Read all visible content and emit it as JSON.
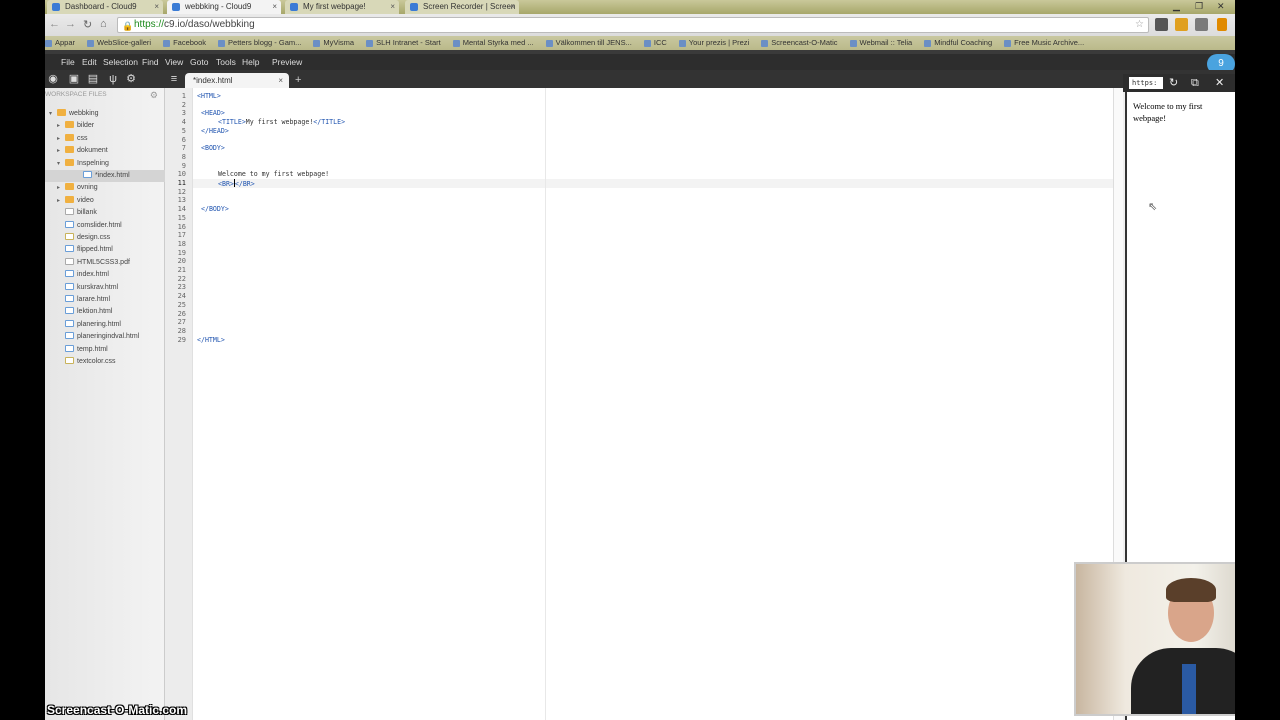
{
  "browser": {
    "tabs": [
      {
        "title": "Dashboard - Cloud9",
        "active": false
      },
      {
        "title": "webbking - Cloud9",
        "active": true
      },
      {
        "title": "My first webpage!",
        "active": false
      },
      {
        "title": "Screen Recorder | Screen",
        "active": false
      }
    ],
    "address": {
      "scheme": "https://",
      "rest": "c9.io/daso/webbking"
    },
    "bookmarks": [
      "Appar",
      "WebSlice-galleri",
      "Facebook",
      "Petters blogg - Gam...",
      "MyVisma",
      "SLH Intranet - Start",
      "Mental Styrka med ...",
      "Välkommen till JENS...",
      "ICC",
      "Your prezis | Prezi",
      "Screencast-O-Matic",
      "Webmail :: Telia",
      "Mindful Coaching",
      "Free Music Archive..."
    ]
  },
  "menu": {
    "items": [
      "File",
      "Edit",
      "Selection",
      "Find",
      "View",
      "Goto",
      "Tools",
      "Help",
      "Preview"
    ]
  },
  "editor_tab": {
    "label": "*index.html",
    "add": "+"
  },
  "sidebar": {
    "header": "WORKSPACE FILES",
    "tree": [
      {
        "label": "webbking",
        "type": "folder",
        "level": 0,
        "expanded": true
      },
      {
        "label": "bilder",
        "type": "folder",
        "level": 1
      },
      {
        "label": "css",
        "type": "folder",
        "level": 1
      },
      {
        "label": "dokument",
        "type": "folder",
        "level": 1
      },
      {
        "label": "Inspelning",
        "type": "folder",
        "level": 1,
        "expanded": true
      },
      {
        "label": "*index.html",
        "type": "html",
        "level": 2,
        "selected": true
      },
      {
        "label": "ovning",
        "type": "folder",
        "level": 1
      },
      {
        "label": "video",
        "type": "folder",
        "level": 1
      },
      {
        "label": "billank",
        "type": "file",
        "level": 1
      },
      {
        "label": "comslider.html",
        "type": "html",
        "level": 1
      },
      {
        "label": "design.css",
        "type": "css",
        "level": 1
      },
      {
        "label": "flipped.html",
        "type": "html",
        "level": 1
      },
      {
        "label": "HTML5CSS3.pdf",
        "type": "file",
        "level": 1
      },
      {
        "label": "index.html",
        "type": "html",
        "level": 1
      },
      {
        "label": "kurskrav.html",
        "type": "html",
        "level": 1
      },
      {
        "label": "larare.html",
        "type": "html",
        "level": 1
      },
      {
        "label": "lektion.html",
        "type": "html",
        "level": 1
      },
      {
        "label": "planering.html",
        "type": "html",
        "level": 1
      },
      {
        "label": "planeringindval.html",
        "type": "html",
        "level": 1
      },
      {
        "label": "temp.html",
        "type": "html",
        "level": 1
      },
      {
        "label": "textcolor.css",
        "type": "css",
        "level": 1
      }
    ]
  },
  "code": {
    "line_count": 29,
    "active_line": 11,
    "lines": {
      "1": "<HTML>",
      "3": "<HEAD>",
      "4_tag_open": "<TITLE>",
      "4_text": "My first webpage!",
      "4_tag_close": "</TITLE>",
      "5": "</HEAD>",
      "7": "<BODY>",
      "10": "Welcome to my first webpage!",
      "11_open": "<BR>",
      "11_close": "</BR>",
      "14": "</BODY>",
      "29": "</HTML>"
    }
  },
  "preview": {
    "url": "https:",
    "content": "Welcome to my first webpage!"
  },
  "watermark": "Screencast-O-Matic.com",
  "colors": {
    "tag": "#2155b0",
    "menu_bg": "#2d2d2d",
    "folder": "#f0b040"
  }
}
